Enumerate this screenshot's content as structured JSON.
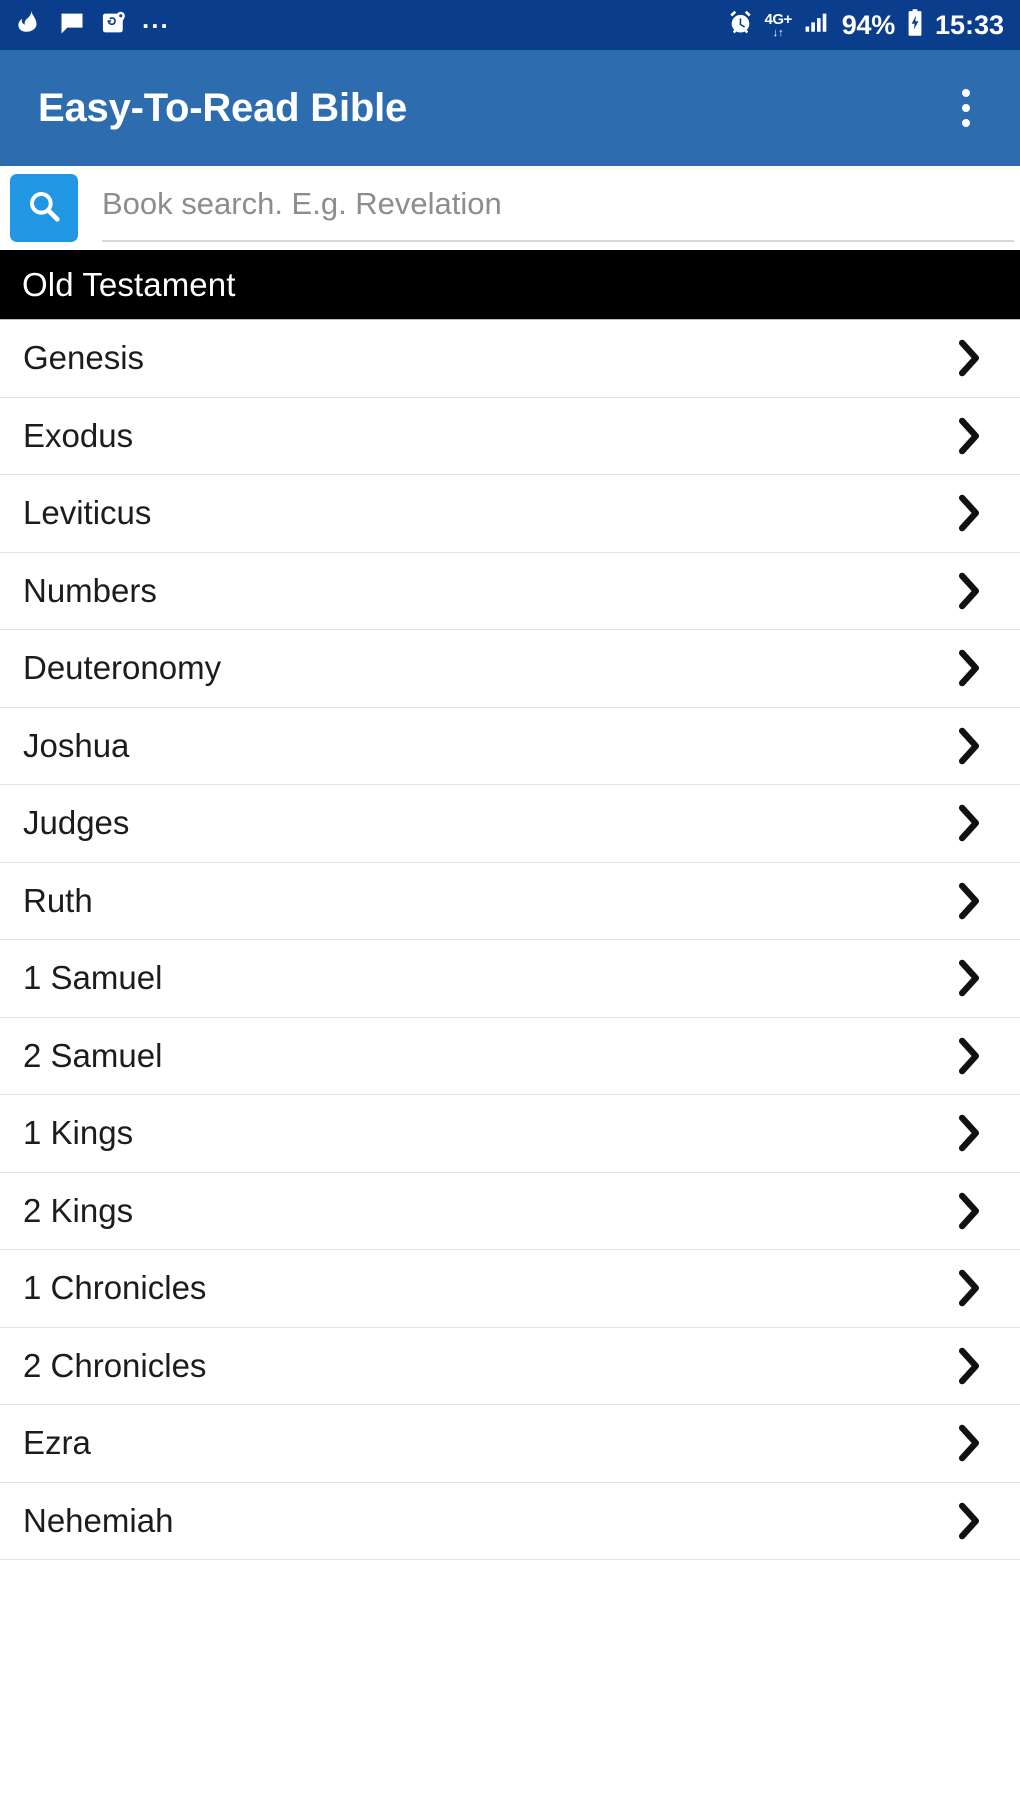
{
  "status_bar": {
    "left_icons": [
      "flame-notification-icon",
      "message-bubble-icon",
      "maps-location-icon"
    ],
    "more_indicator": "...",
    "alarm_icon": "alarm-clock-icon",
    "network_type": "4G+",
    "network_arrows": "↓↑",
    "signal_icon": "signal-bars-icon",
    "battery_percent": "94%",
    "battery_icon": "battery-charging-icon",
    "time": "15:33",
    "background_color": "#0a3d8c"
  },
  "app_bar": {
    "title": "Easy-To-Read Bible",
    "overflow_menu": "overflow-menu-icon",
    "background_color": "#2e6cb0"
  },
  "search": {
    "button_icon": "search-icon",
    "button_color": "#2196e3",
    "value": "",
    "placeholder": "Book search. E.g. Revelation"
  },
  "section": {
    "label": "Old Testament",
    "background_color": "#000000"
  },
  "books": [
    {
      "name": "Genesis",
      "chevron": "chevron-right-icon"
    },
    {
      "name": "Exodus",
      "chevron": "chevron-right-icon"
    },
    {
      "name": "Leviticus",
      "chevron": "chevron-right-icon"
    },
    {
      "name": "Numbers",
      "chevron": "chevron-right-icon"
    },
    {
      "name": "Deuteronomy",
      "chevron": "chevron-right-icon"
    },
    {
      "name": "Joshua",
      "chevron": "chevron-right-icon"
    },
    {
      "name": "Judges",
      "chevron": "chevron-right-icon"
    },
    {
      "name": "Ruth",
      "chevron": "chevron-right-icon"
    },
    {
      "name": "1 Samuel",
      "chevron": "chevron-right-icon"
    },
    {
      "name": "2 Samuel",
      "chevron": "chevron-right-icon"
    },
    {
      "name": "1 Kings",
      "chevron": "chevron-right-icon"
    },
    {
      "name": "2 Kings",
      "chevron": "chevron-right-icon"
    },
    {
      "name": "1 Chronicles",
      "chevron": "chevron-right-icon"
    },
    {
      "name": "2 Chronicles",
      "chevron": "chevron-right-icon"
    },
    {
      "name": "Ezra",
      "chevron": "chevron-right-icon"
    },
    {
      "name": "Nehemiah",
      "chevron": "chevron-right-icon"
    }
  ]
}
